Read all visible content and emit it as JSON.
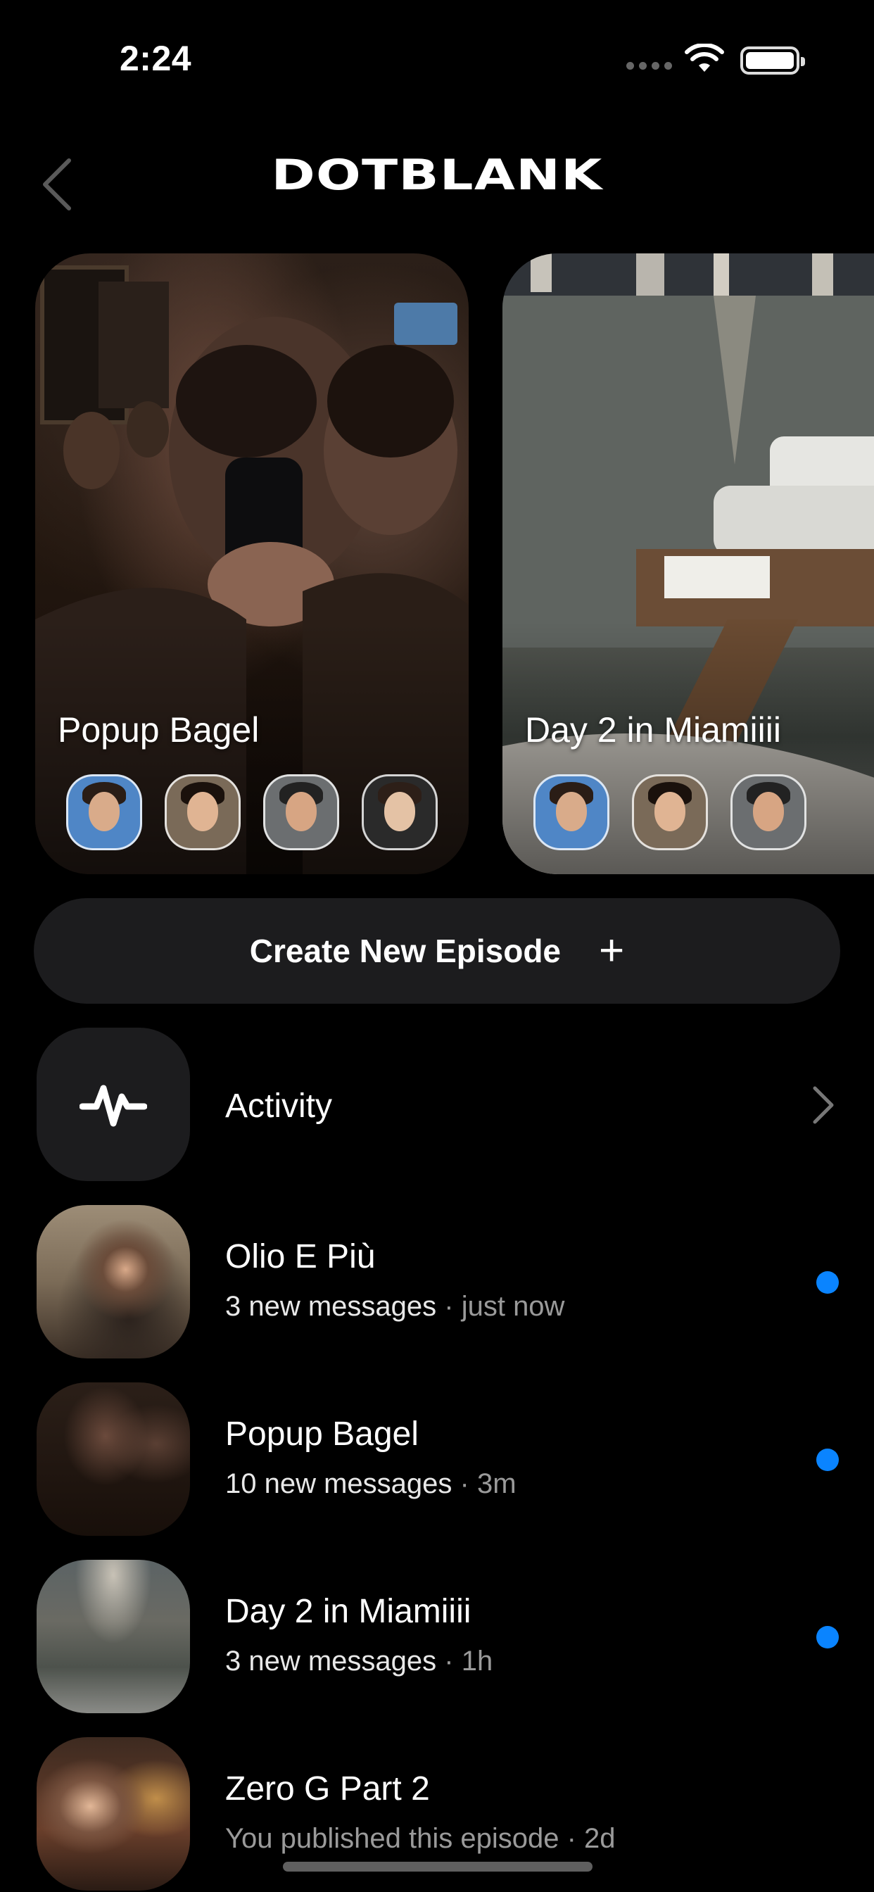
{
  "status_bar": {
    "time": "2:24"
  },
  "header": {
    "title": "DOTBLANK"
  },
  "episodes": [
    {
      "title": "Popup Bagel"
    },
    {
      "title": "Day 2 in Miamiiii"
    }
  ],
  "create_button": {
    "label": "Create New Episode",
    "icon": "plus-icon"
  },
  "activity": {
    "label": "Activity",
    "icon": "activity-pulse-icon"
  },
  "list": [
    {
      "title": "Olio E Più",
      "count_text": "3 new messages",
      "time": " · just now",
      "unread": true
    },
    {
      "title": "Popup Bagel",
      "count_text": "10 new messages",
      "time": " · 3m",
      "unread": true
    },
    {
      "title": "Day 2 in Miamiiii",
      "count_text": "3 new messages",
      "time": " · 1h",
      "unread": true
    },
    {
      "title": "Zero G Part 2",
      "count_text": "You published this episode · 2d",
      "time": "",
      "unread": false
    }
  ],
  "colors": {
    "unread_dot": "#0a84ff",
    "button_bg": "#1c1c1e",
    "secondary_text": "#9a9a9a"
  }
}
